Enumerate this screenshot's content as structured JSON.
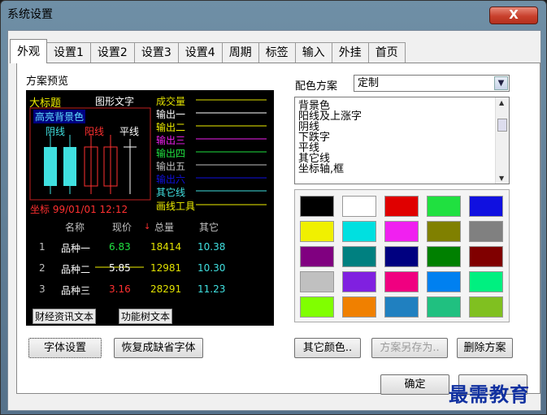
{
  "window": {
    "title": "系统设置",
    "close_label": "X"
  },
  "tabs": [
    "外观",
    "设置1",
    "设置2",
    "设置3",
    "设置4",
    "周期",
    "标签",
    "输入",
    "外挂",
    "首页"
  ],
  "left": {
    "section_label": "方案预览",
    "preview": {
      "big_title": "大标题",
      "graph_text": "图形文字",
      "volume": "成交量",
      "highlight_bg": "高亮背景色",
      "yin_line": "阴线",
      "yang_line": "阳线",
      "flat_line": "平线",
      "outputs": [
        "输出一",
        "输出二",
        "输出三",
        "输出四",
        "输出五",
        "输出六"
      ],
      "other_line": "其它线",
      "draw_tool": "画线工具",
      "coord": "坐标 99/01/01 12:12",
      "table_headers": [
        "名称",
        "现价",
        "总量",
        "其它"
      ],
      "rows": [
        {
          "idx": "1",
          "name": "品种一",
          "price": "6.83",
          "vol": "18414",
          "other": "10.38"
        },
        {
          "idx": "2",
          "name": "品种二",
          "price": "5.85",
          "vol": "12981",
          "other": "10.30"
        },
        {
          "idx": "3",
          "name": "品种三",
          "price": "3.16",
          "vol": "28291",
          "other": "11.23"
        }
      ],
      "news_text": "财经资讯文本",
      "func_tree_text": "功能树文本"
    },
    "font_button": "字体设置",
    "restore_button": "恢复成缺省字体"
  },
  "right": {
    "scheme_label": "配色方案",
    "scheme_value": "定制",
    "items": [
      "背景色",
      "阳线及上涨字",
      "阴线",
      "下跌字",
      "平线",
      "其它线",
      "坐标轴,框"
    ],
    "swatches": [
      "#000000",
      "#ffffff",
      "#e00000",
      "#20e040",
      "#1010e0",
      "#f0f000",
      "#00e0e0",
      "#f020f0",
      "#808000",
      "#808080",
      "#800080",
      "#008080",
      "#000080",
      "#008000",
      "#800000",
      "#c0c0c0",
      "#8020e0",
      "#f00080",
      "#0080f0",
      "#00f080",
      "#80ff00",
      "#f08000",
      "#2080c0",
      "#20c080",
      "#80c020"
    ],
    "other_color_button": "其它颜色..",
    "save_as_button": "方案另存为..",
    "delete_button": "删除方案"
  },
  "footer": {
    "ok": "确定"
  },
  "watermark": "最需教育"
}
